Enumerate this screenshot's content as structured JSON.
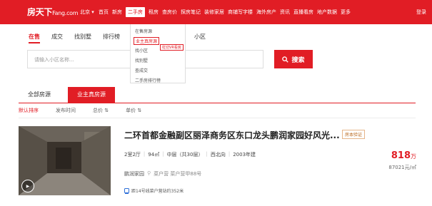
{
  "header": {
    "logo": "房天下",
    "logo_domain": "Fang.com",
    "city": "北京",
    "nav": [
      "首页",
      "新房",
      "二手房",
      "租房",
      "查房价",
      "探房笔记",
      "装修家居",
      "商铺写字楼",
      "海外房产",
      "资讯",
      "直播看房",
      "地产数据",
      "更多"
    ],
    "active_index": 2,
    "login": "登录"
  },
  "dropdown": {
    "items": [
      "在售房源",
      "业主真房源",
      "找小区",
      "找别墅",
      "查成交",
      "二手房排行榜"
    ],
    "selected_index": 1,
    "tooltip": "虹切VR看房"
  },
  "tabs": {
    "items": [
      "在售",
      "成交",
      "找别墅",
      "排行榜"
    ],
    "active_index": 0,
    "extra": "小区"
  },
  "search": {
    "placeholder": "请输入小区名称...",
    "button_label": "搜索"
  },
  "filter_tabs": [
    "全部房源",
    "业主真房源"
  ],
  "sort": [
    "默认排序",
    "发布时间",
    "总价",
    "单价"
  ],
  "listing": {
    "title": "二环首都金融副区丽泽商务区东口龙头鹏润家园好风光...",
    "badge": "房本验证",
    "layout": "2室2厅",
    "area": "94㎡",
    "floor": "中层（共30层）",
    "orientation": "西北向",
    "year": "2003年建",
    "community": "鹏润家园",
    "address": "菜户营 菜户营甲88号",
    "subway": "距14号线菜户营站约352米",
    "price": "818",
    "price_unit": "万",
    "unit_price": "87021元/㎡"
  }
}
